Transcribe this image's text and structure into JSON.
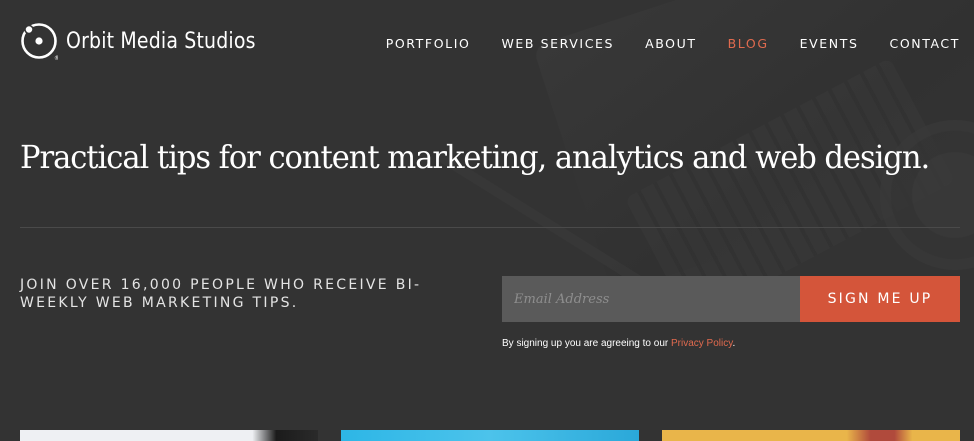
{
  "brand": {
    "name": "Orbit Media Studios",
    "registered_mark": "®"
  },
  "nav": {
    "items": [
      {
        "label": "PORTFOLIO"
      },
      {
        "label": "WEB SERVICES"
      },
      {
        "label": "ABOUT"
      },
      {
        "label": "BLOG",
        "active": true
      },
      {
        "label": "EVENTS"
      },
      {
        "label": "CONTACT"
      }
    ]
  },
  "hero": {
    "headline": "Practical tips for content marketing, analytics and web design."
  },
  "newsletter": {
    "pitch": "JOIN OVER 16,000 PEOPLE WHO RECEIVE BI-WEEKLY WEB MARKETING TIPS.",
    "email_placeholder": "Email Address",
    "button_label": "SIGN ME UP",
    "policy_prefix": "By signing up you are agreeing to our ",
    "policy_link": "Privacy Policy",
    "policy_suffix": "."
  },
  "colors": {
    "background": "#333333",
    "accent": "#e06a4e",
    "button": "#d4553a",
    "input": "#5a5a5a"
  },
  "icons": {
    "logo": "orbit-logo-icon"
  }
}
